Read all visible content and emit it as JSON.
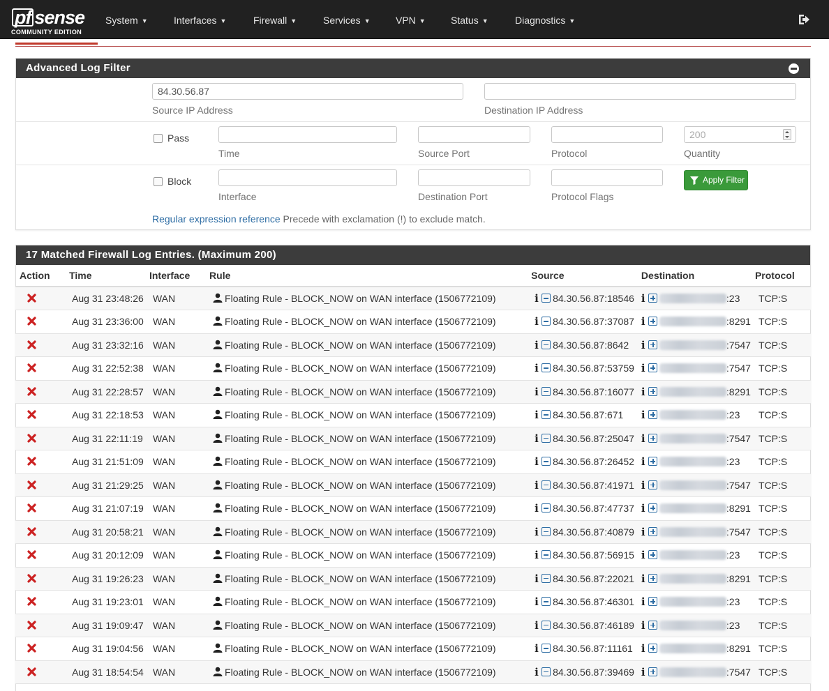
{
  "brand": {
    "logo_main": "sense",
    "logo_pf": "pf",
    "edition": "COMMUNITY EDITION"
  },
  "nav": {
    "items": [
      "System",
      "Interfaces",
      "Firewall",
      "Services",
      "VPN",
      "Status",
      "Diagnostics"
    ]
  },
  "colors": {
    "navbar": "#212121",
    "panel_heading": "#3c3c3c",
    "accent_red": "#c0392b",
    "apply_green": "#3a9a3a",
    "link_blue": "#2e6da4"
  },
  "filter": {
    "title": "Advanced Log Filter",
    "source_ip": {
      "value": "84.30.56.87",
      "help": "Source IP Address"
    },
    "dest_ip": {
      "value": "",
      "help": "Destination IP Address"
    },
    "pass_label": "Pass",
    "block_label": "Block",
    "time_help": "Time",
    "source_port_help": "Source Port",
    "protocol_help": "Protocol",
    "quantity": {
      "placeholder": "200",
      "help": "Quantity"
    },
    "interface_help": "Interface",
    "dest_port_help": "Destination Port",
    "protocol_flags_help": "Protocol Flags",
    "apply_label": "Apply Filter",
    "regex_link": "Regular expression reference",
    "regex_note": "Precede with exclamation (!) to exclude match."
  },
  "log": {
    "title": "17 Matched Firewall Log Entries. (Maximum 200)",
    "columns": {
      "action": "Action",
      "time": "Time",
      "interface": "Interface",
      "rule": "Rule",
      "source": "Source",
      "destination": "Destination",
      "protocol": "Protocol"
    },
    "rows": [
      {
        "action": "block",
        "time": "Aug 31 23:48:26",
        "interface": "WAN",
        "rule": "Floating Rule - BLOCK_NOW on WAN interface (1506772109)",
        "source": "84.30.56.87:18546",
        "dest_port": ":23",
        "protocol": "TCP:S"
      },
      {
        "action": "block",
        "time": "Aug 31 23:36:00",
        "interface": "WAN",
        "rule": "Floating Rule - BLOCK_NOW on WAN interface (1506772109)",
        "source": "84.30.56.87:37087",
        "dest_port": ":8291",
        "protocol": "TCP:S"
      },
      {
        "action": "block",
        "time": "Aug 31 23:32:16",
        "interface": "WAN",
        "rule": "Floating Rule - BLOCK_NOW on WAN interface (1506772109)",
        "source": "84.30.56.87:8642",
        "dest_port": ":7547",
        "protocol": "TCP:S"
      },
      {
        "action": "block",
        "time": "Aug 31 22:52:38",
        "interface": "WAN",
        "rule": "Floating Rule - BLOCK_NOW on WAN interface (1506772109)",
        "source": "84.30.56.87:53759",
        "dest_port": ":7547",
        "protocol": "TCP:S"
      },
      {
        "action": "block",
        "time": "Aug 31 22:28:57",
        "interface": "WAN",
        "rule": "Floating Rule - BLOCK_NOW on WAN interface (1506772109)",
        "source": "84.30.56.87:16077",
        "dest_port": ":8291",
        "protocol": "TCP:S"
      },
      {
        "action": "block",
        "time": "Aug 31 22:18:53",
        "interface": "WAN",
        "rule": "Floating Rule - BLOCK_NOW on WAN interface (1506772109)",
        "source": "84.30.56.87:671",
        "dest_port": ":23",
        "protocol": "TCP:S"
      },
      {
        "action": "block",
        "time": "Aug 31 22:11:19",
        "interface": "WAN",
        "rule": "Floating Rule - BLOCK_NOW on WAN interface (1506772109)",
        "source": "84.30.56.87:25047",
        "dest_port": ":7547",
        "protocol": "TCP:S"
      },
      {
        "action": "block",
        "time": "Aug 31 21:51:09",
        "interface": "WAN",
        "rule": "Floating Rule - BLOCK_NOW on WAN interface (1506772109)",
        "source": "84.30.56.87:26452",
        "dest_port": ":23",
        "protocol": "TCP:S"
      },
      {
        "action": "block",
        "time": "Aug 31 21:29:25",
        "interface": "WAN",
        "rule": "Floating Rule - BLOCK_NOW on WAN interface (1506772109)",
        "source": "84.30.56.87:41971",
        "dest_port": ":7547",
        "protocol": "TCP:S"
      },
      {
        "action": "block",
        "time": "Aug 31 21:07:19",
        "interface": "WAN",
        "rule": "Floating Rule - BLOCK_NOW on WAN interface (1506772109)",
        "source": "84.30.56.87:47737",
        "dest_port": ":8291",
        "protocol": "TCP:S"
      },
      {
        "action": "block",
        "time": "Aug 31 20:58:21",
        "interface": "WAN",
        "rule": "Floating Rule - BLOCK_NOW on WAN interface (1506772109)",
        "source": "84.30.56.87:40879",
        "dest_port": ":7547",
        "protocol": "TCP:S"
      },
      {
        "action": "block",
        "time": "Aug 31 20:12:09",
        "interface": "WAN",
        "rule": "Floating Rule - BLOCK_NOW on WAN interface (1506772109)",
        "source": "84.30.56.87:56915",
        "dest_port": ":23",
        "protocol": "TCP:S"
      },
      {
        "action": "block",
        "time": "Aug 31 19:26:23",
        "interface": "WAN",
        "rule": "Floating Rule - BLOCK_NOW on WAN interface (1506772109)",
        "source": "84.30.56.87:22021",
        "dest_port": ":8291",
        "protocol": "TCP:S"
      },
      {
        "action": "block",
        "time": "Aug 31 19:23:01",
        "interface": "WAN",
        "rule": "Floating Rule - BLOCK_NOW on WAN interface (1506772109)",
        "source": "84.30.56.87:46301",
        "dest_port": ":23",
        "protocol": "TCP:S"
      },
      {
        "action": "block",
        "time": "Aug 31 19:09:47",
        "interface": "WAN",
        "rule": "Floating Rule - BLOCK_NOW on WAN interface (1506772109)",
        "source": "84.30.56.87:46189",
        "dest_port": ":23",
        "protocol": "TCP:S"
      },
      {
        "action": "block",
        "time": "Aug 31 19:04:56",
        "interface": "WAN",
        "rule": "Floating Rule - BLOCK_NOW on WAN interface (1506772109)",
        "source": "84.30.56.87:11161",
        "dest_port": ":8291",
        "protocol": "TCP:S"
      },
      {
        "action": "block",
        "time": "Aug 31 18:54:54",
        "interface": "WAN",
        "rule": "Floating Rule - BLOCK_NOW on WAN interface (1506772109)",
        "source": "84.30.56.87:39469",
        "dest_port": ":7547",
        "protocol": "TCP:S"
      }
    ]
  }
}
